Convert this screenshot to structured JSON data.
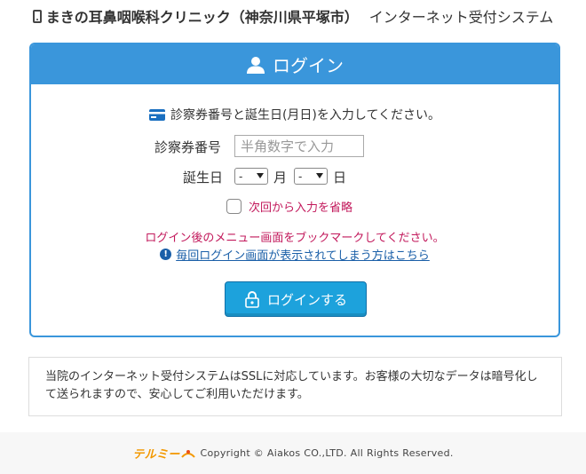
{
  "header": {
    "clinic_name": "まきの耳鼻咽喉科クリニック（神奈川県平塚市）",
    "system_name": "インターネット受付システム"
  },
  "login": {
    "title": "ログイン",
    "instruction": "診察券番号と誕生日(月日)を入力してください。",
    "card_label": "診察券番号",
    "card_placeholder": "半角数字で入力",
    "birthday_label": "誕生日",
    "month_value": "-",
    "month_unit": "月",
    "day_value": "-",
    "day_unit": "日",
    "skip_label": "次回から入力を省略",
    "bookmark_note": "ログイン後のメニュー画面をブックマークしてください。",
    "help_link": "毎回ログイン画面が表示されてしまう方はこちら",
    "submit_label": "ログインする"
  },
  "ssl_notice": "当院のインターネット受付システムはSSLに対応しています。お客様の大切なデータは暗号化して送られますので、安心してご利用いただけます。",
  "footer": {
    "logo_text": "テルミー",
    "copyright": "Copyright © Aiakos CO.,LTD. All Rights Reserved."
  },
  "colors": {
    "primary": "#3a96db",
    "button": "#1da2dc",
    "accent_pink": "#c2185b",
    "link": "#1a5fa8"
  },
  "icons": [
    "phone-icon",
    "user-icon",
    "card-icon",
    "info-icon",
    "lock-icon"
  ]
}
